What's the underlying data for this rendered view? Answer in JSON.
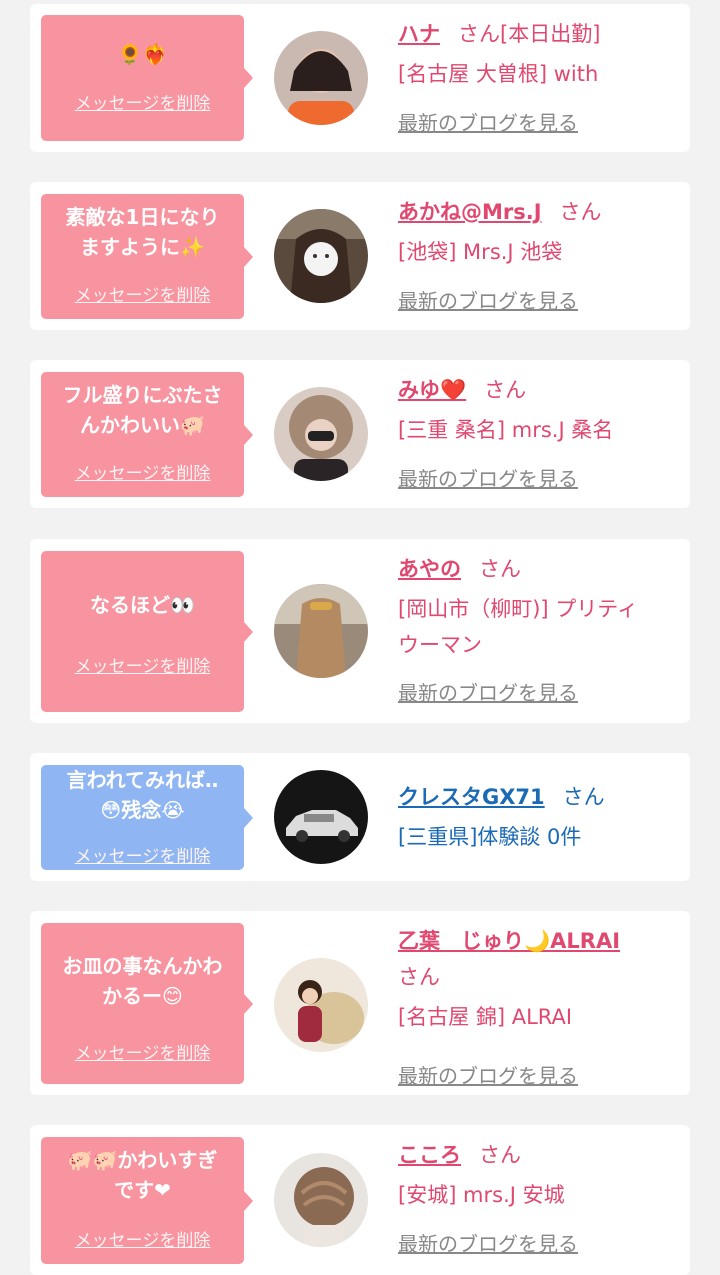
{
  "delete_label": "メッセージを削除",
  "blog_label": "最新のブログを見る",
  "san_label": "さん",
  "items": [
    {
      "message": "🌻❤️‍🔥",
      "name": "ハナ",
      "tag": "[本日出勤]",
      "shop": "[名古屋 大曽根] with",
      "bubble_color": "#f8949f",
      "show_blog": true
    },
    {
      "message": "素敵な1日になり\nますように✨",
      "name": "あかね@Mrs.J",
      "shop": "[池袋] Mrs.J 池袋",
      "bubble_color": "#f8949f",
      "show_blog": true
    },
    {
      "message": "フル盛りにぶたさ\nんかわいい🐖",
      "name": "みゆ❤️",
      "shop": "[三重 桑名] mrs.J 桑名",
      "bubble_color": "#f8949f",
      "show_blog": true
    },
    {
      "message": "なるほど👀",
      "name": "あやの",
      "shop": "[岡山市（柳町)] プリティ\nウーマン",
      "bubble_color": "#f8949f",
      "show_blog": true
    },
    {
      "message": "言われてみれば‥\n😳残念😭",
      "name": "クレスタGX71",
      "shop": "[三重県]体験談 0件",
      "bubble_color": "#8fb6f2",
      "show_blog": false
    },
    {
      "message": "お皿の事なんかわ\nかるー😊",
      "name": "乙葉　じゅり🌙ALRAI",
      "shop": "[名古屋 錦] ALRAI",
      "bubble_color": "#f8949f",
      "show_blog": true
    },
    {
      "message": "🐖🐖かわいすぎ\nです❤",
      "name": "こころ",
      "shop": "[安城] mrs.J 安城",
      "bubble_color": "#f8949f",
      "show_blog": true
    }
  ]
}
